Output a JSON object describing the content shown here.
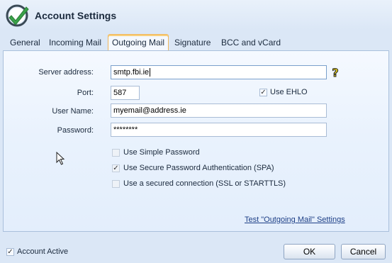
{
  "window": {
    "title": "Account Settings"
  },
  "tabs": [
    {
      "label": "General"
    },
    {
      "label": "Incoming Mail"
    },
    {
      "label": "Outgoing Mail",
      "active": true
    },
    {
      "label": "Signature"
    },
    {
      "label": "BCC and vCard"
    }
  ],
  "form": {
    "server_label": "Server address:",
    "server_value": "smtp.fbi.ie",
    "port_label": "Port:",
    "port_value": "587",
    "use_ehlo_label": "Use EHLO",
    "use_ehlo_checked": true,
    "username_label": "User Name:",
    "username_value": "myemail@address.ie",
    "password_label": "Password:",
    "password_value": "********",
    "options": [
      {
        "label": "Use Simple Password",
        "checked": false,
        "disabled": true
      },
      {
        "label": "Use Secure Password Authentication (SPA)",
        "checked": true,
        "disabled": true
      },
      {
        "label": "Use a secured connection (SSL or STARTTLS)",
        "checked": false,
        "disabled": true
      }
    ],
    "test_link": "Test \"Outgoing Mail\" Settings"
  },
  "footer": {
    "account_active_label": "Account Active",
    "account_active_checked": true,
    "ok_label": "OK",
    "cancel_label": "Cancel"
  },
  "icons": {
    "app": "green-checkmark-logo-icon",
    "help": "question-mark-help-icon",
    "cursor": "mouse-pointer-icon",
    "checkmark_glyph": "✓"
  },
  "colors": {
    "active_tab_border": "#f0b65a",
    "link": "#1d3f86",
    "logo_green": "#3aa24a"
  }
}
